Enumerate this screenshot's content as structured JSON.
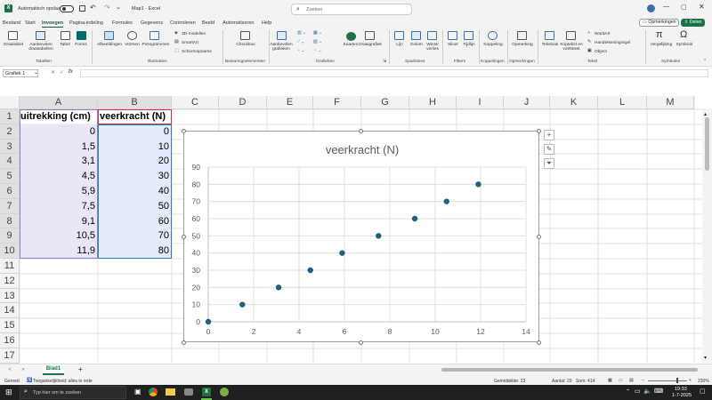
{
  "titlebar": {
    "autosave_label": "Automatisch opslaan",
    "autosave_state": "Uit",
    "filename": "Map1 · Excel",
    "search_placeholder": "Zoeken"
  },
  "menu": {
    "items": [
      "Bestand",
      "Start",
      "Invoegen",
      "Pagina-indeling",
      "Formules",
      "Gegevens",
      "Controleren",
      "Beeld",
      "Automatiseren",
      "Help"
    ],
    "active_index": 2,
    "comments_label": "Opmerkingen",
    "share_label": "Delen"
  },
  "ribbon": {
    "buttons": {
      "draaitabel": "Draaitabel",
      "aanbevolen_draaitabellen": "Aanbevolen draaitabellen",
      "tabel": "Tabel",
      "forms": "Forms",
      "afbeeldingen": "Afbeeldingen",
      "vormen": "Vormen",
      "pictogrammen": "Pictogrammen",
      "modellen3d": "3D-modellen",
      "smartart": "SmartArt",
      "schermopname": "Schermopname",
      "checkbox": "Checkbox",
      "aanbevolen_grafieken": "Aanbevolen grafieken",
      "kaarten": "Kaarten",
      "draaigrafiek": "Draaigrafiek",
      "lijn": "Lijn",
      "kolom": "Kolom",
      "winst_verlies": "Winst/ verlies",
      "slicer": "Slicer",
      "tijdlijn": "Tijdlijn",
      "koppeling": "Koppeling",
      "opmerking": "Opmerking",
      "tekstvak": "Tekstvak",
      "koptekst_voettekst": "Koptekst en voettekst",
      "wordart": "WordArt",
      "handtekeningregel": "Handtekeningregel",
      "object": "Object",
      "vergelijking": "Vergelijking",
      "symbool": "Symbool"
    },
    "groups": [
      "Tabellen",
      "Illustraties",
      "Besturingselementen",
      "Grafieken",
      "Sparklines",
      "Filters",
      "Koppelingen",
      "Opmerkingen",
      "Tekst",
      "Symbolen"
    ]
  },
  "formulabar": {
    "namebox": "Grafiek 1",
    "fx": "fx"
  },
  "columns": [
    "A",
    "B",
    "C",
    "D",
    "E",
    "F",
    "G",
    "H",
    "I",
    "J",
    "K",
    "L",
    "M"
  ],
  "rows": [
    "1",
    "2",
    "3",
    "4",
    "5",
    "6",
    "7",
    "8",
    "9",
    "10",
    "11",
    "12",
    "13",
    "14",
    "15",
    "16",
    "17"
  ],
  "table": {
    "header_a": "uitrekking (cm)",
    "header_b": "veerkracht (N)",
    "a_values": [
      "0",
      "1,5",
      "3,1",
      "4,5",
      "5,9",
      "7,5",
      "9,1",
      "10,5",
      "11,9"
    ],
    "b_values": [
      "0",
      "10",
      "20",
      "30",
      "40",
      "50",
      "60",
      "70",
      "80"
    ]
  },
  "chart_data": {
    "type": "scatter",
    "title": "veerkracht (N)",
    "x": [
      0,
      1.5,
      3.1,
      4.5,
      5.9,
      7.5,
      9.1,
      10.5,
      11.9
    ],
    "y": [
      0,
      10,
      20,
      30,
      40,
      50,
      60,
      70,
      80
    ],
    "xlim": [
      0,
      14
    ],
    "ylim": [
      0,
      90
    ],
    "x_ticks": [
      0,
      2,
      4,
      6,
      8,
      10,
      12,
      14
    ],
    "y_ticks": [
      0,
      10,
      20,
      30,
      40,
      50,
      60,
      70,
      80,
      90
    ],
    "grid": true,
    "legend": "none",
    "marker_color": "#1f5f80"
  },
  "sheettabs": {
    "active": "Blad1",
    "add": "+"
  },
  "status": {
    "ready": "Gereed",
    "accessibility": "Toegankelijkheid: alles in orde",
    "average": "Gemiddelde: 23",
    "count": "Aantal: 20",
    "sum": "Som: 414",
    "zoom": "230%"
  },
  "taskbar": {
    "search_placeholder": "Typ hier om te zoeken",
    "time": "19:33",
    "date": "1-7-2025"
  },
  "colors": {
    "excel_green": "#1e7145",
    "header_a_border": "#c33",
    "header_b_border": "#c33",
    "col_a_fill": "#e9e6f5",
    "col_b_fill": "#e3ecf8"
  }
}
